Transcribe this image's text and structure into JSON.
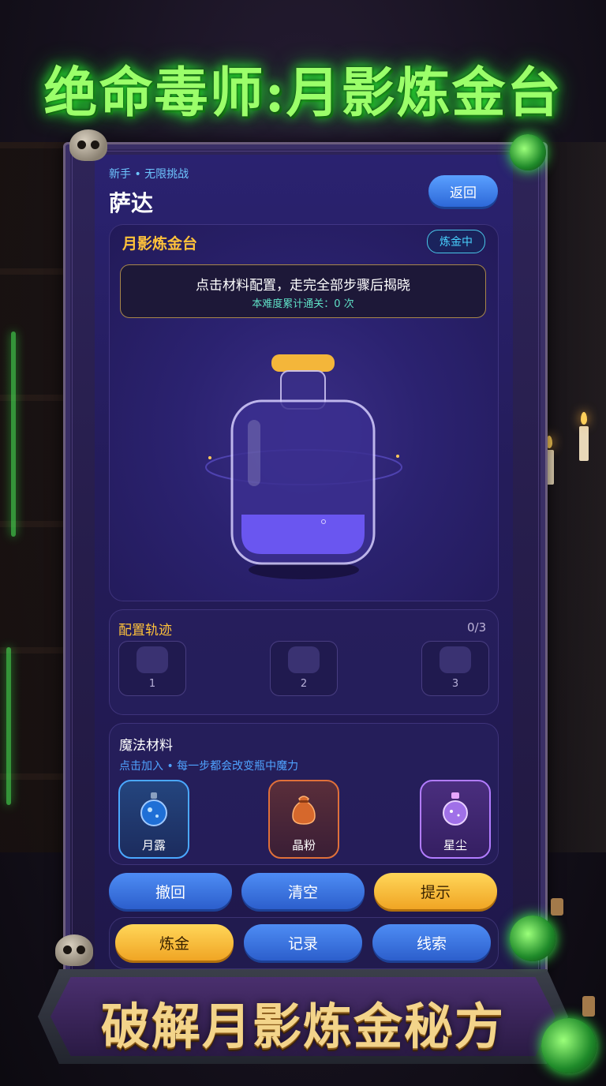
{
  "top_title": "绝命毒师:月影炼金台",
  "header": {
    "subtitle": "新手 • 无限挑战",
    "player_name": "萨达",
    "back_label": "返回"
  },
  "stage": {
    "title": "月影炼金台",
    "status": "炼金中",
    "hint_main": "点击材料配置，走完全部步骤后揭晓",
    "hint_sub": "本难度累计通关：0 次",
    "liquid_color": "#6a56f0"
  },
  "track": {
    "title": "配置轨迹",
    "count": "0/3",
    "slots": [
      "1",
      "2",
      "3"
    ]
  },
  "materials": {
    "title": "魔法材料",
    "subtitle": "点击加入 • 每一步都会改变瓶中魔力",
    "items": [
      {
        "label": "月露",
        "icon": "moon-dew-flask-icon",
        "color": "#4aa8ff"
      },
      {
        "label": "晶粉",
        "icon": "crystal-powder-pouch-icon",
        "color": "#e0703a"
      },
      {
        "label": "星尘",
        "icon": "stardust-bottle-icon",
        "color": "#b27cff"
      }
    ]
  },
  "actions": {
    "undo": "撤回",
    "clear": "清空",
    "hint": "提示"
  },
  "bottom_nav": {
    "alchemy": "炼金",
    "records": "记录",
    "clues": "线索"
  },
  "banner": "破解月影炼金秘方"
}
